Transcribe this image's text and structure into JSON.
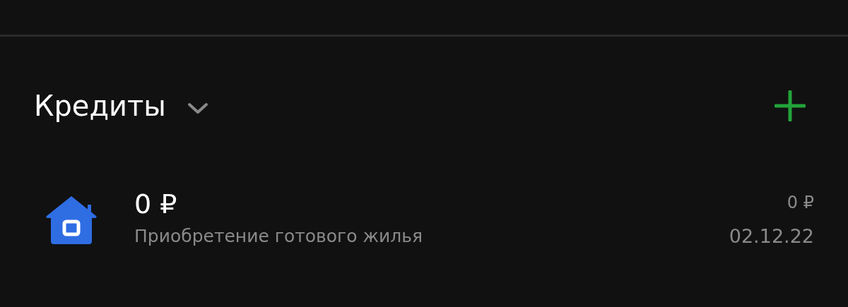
{
  "section": {
    "title": "Кредиты"
  },
  "loans": [
    {
      "amount": "0 ₽",
      "name": "Приобретение готового жилья",
      "side_amount": "0 ₽",
      "date": "02.12.22"
    }
  ]
}
